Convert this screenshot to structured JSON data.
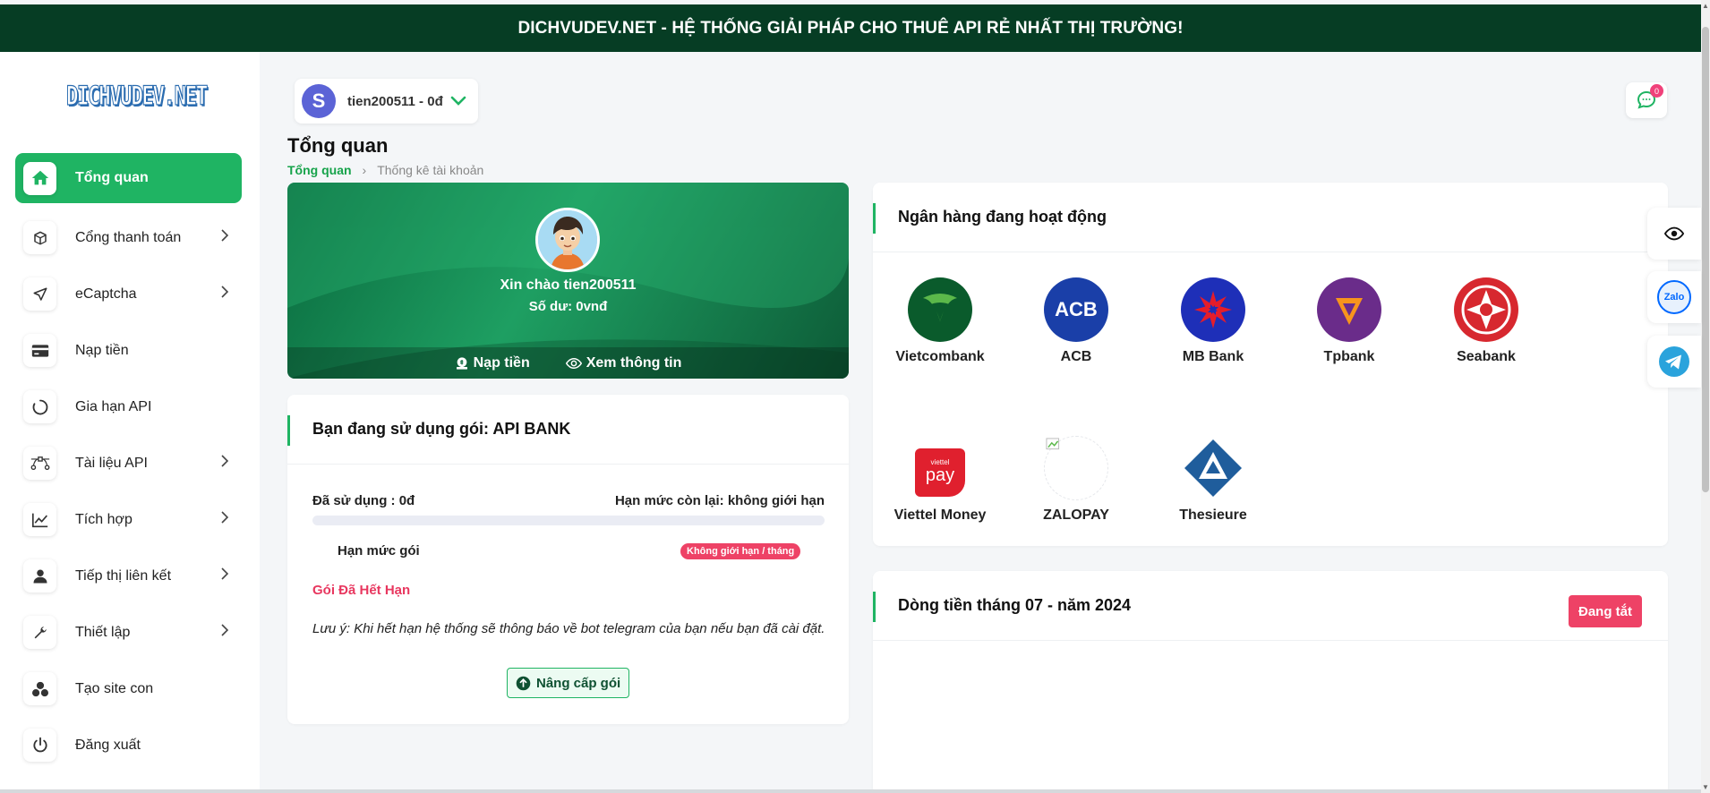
{
  "topbar": {
    "text": "DICHVUDEV.NET - HỆ THỐNG GIẢI PHÁP CHO THUÊ API RẺ NHẤT THỊ TRƯỜNG!"
  },
  "sidebar": {
    "logo": "DICHVUDEV.NET",
    "items": [
      {
        "label": "Tổng quan",
        "icon": "home-icon",
        "active": true
      },
      {
        "label": "Cổng thanh toán",
        "icon": "box-icon"
      },
      {
        "label": "eCaptcha",
        "icon": "send-icon"
      },
      {
        "label": "Nạp tiền",
        "icon": "card-icon"
      },
      {
        "label": "Gia hạn API",
        "icon": "circle-icon"
      },
      {
        "label": "Tài liệu API",
        "icon": "bezier-icon"
      },
      {
        "label": "Tích hợp",
        "icon": "chart-icon"
      },
      {
        "label": "Tiếp thị liên kết",
        "icon": "user-icon"
      },
      {
        "label": "Thiết lập",
        "icon": "wrench-icon"
      },
      {
        "label": "Tạo site con",
        "icon": "cluster-icon"
      },
      {
        "label": "Đăng xuất",
        "icon": "power-icon"
      }
    ]
  },
  "header": {
    "avatar_letter": "S",
    "user_label": "tien200511 - 0đ",
    "chat_badge": "0"
  },
  "page": {
    "title": "Tổng quan",
    "breadcrumb": {
      "current": "Tổng quan",
      "child": "Thống kê tài khoản"
    }
  },
  "hero": {
    "greeting": "Xin chào tien200511",
    "balance": "Số dư: 0vnđ",
    "deposit": "Nạp tiền",
    "view_info": "Xem thông tin"
  },
  "package": {
    "title": "Bạn đang sử dụng gói: API BANK",
    "used": "Đã sử dụng : 0đ",
    "remaining": "Hạn mức còn lại: không giới hạn",
    "usage_fraction": 0,
    "limit_label": "Hạn mức gói",
    "limit_badge": "Không giới hạn / tháng",
    "expired": "Gói Đã Hết Hạn",
    "note": "Lưu ý: Khi hết hạn hệ thống sẽ thông báo về bot telegram của bạn nếu bạn đã cài đặt.",
    "upgrade": "Nâng cấp gói"
  },
  "banks": {
    "title": "Ngân hàng đang hoạt động",
    "list": [
      {
        "name": "Vietcombank",
        "color": "#0a5b2c"
      },
      {
        "name": "ACB",
        "color": "#1a3fa8"
      },
      {
        "name": "MB Bank",
        "color": "#1e2fb8"
      },
      {
        "name": "Tpbank",
        "color": "#6a2c8a"
      },
      {
        "name": "Seabank",
        "color": "#d7282f"
      },
      {
        "name": "Viettel Money",
        "color": "#e0202e"
      },
      {
        "name": "ZALOPAY",
        "color": "#ffffff"
      },
      {
        "name": "Thesieure",
        "color": "#1f5d9c"
      }
    ]
  },
  "cashflow": {
    "title": "Dòng tiền tháng 07 - năm 2024",
    "status_button": "Đang tắt"
  },
  "floating": {
    "zalo_label": "Zalo"
  }
}
